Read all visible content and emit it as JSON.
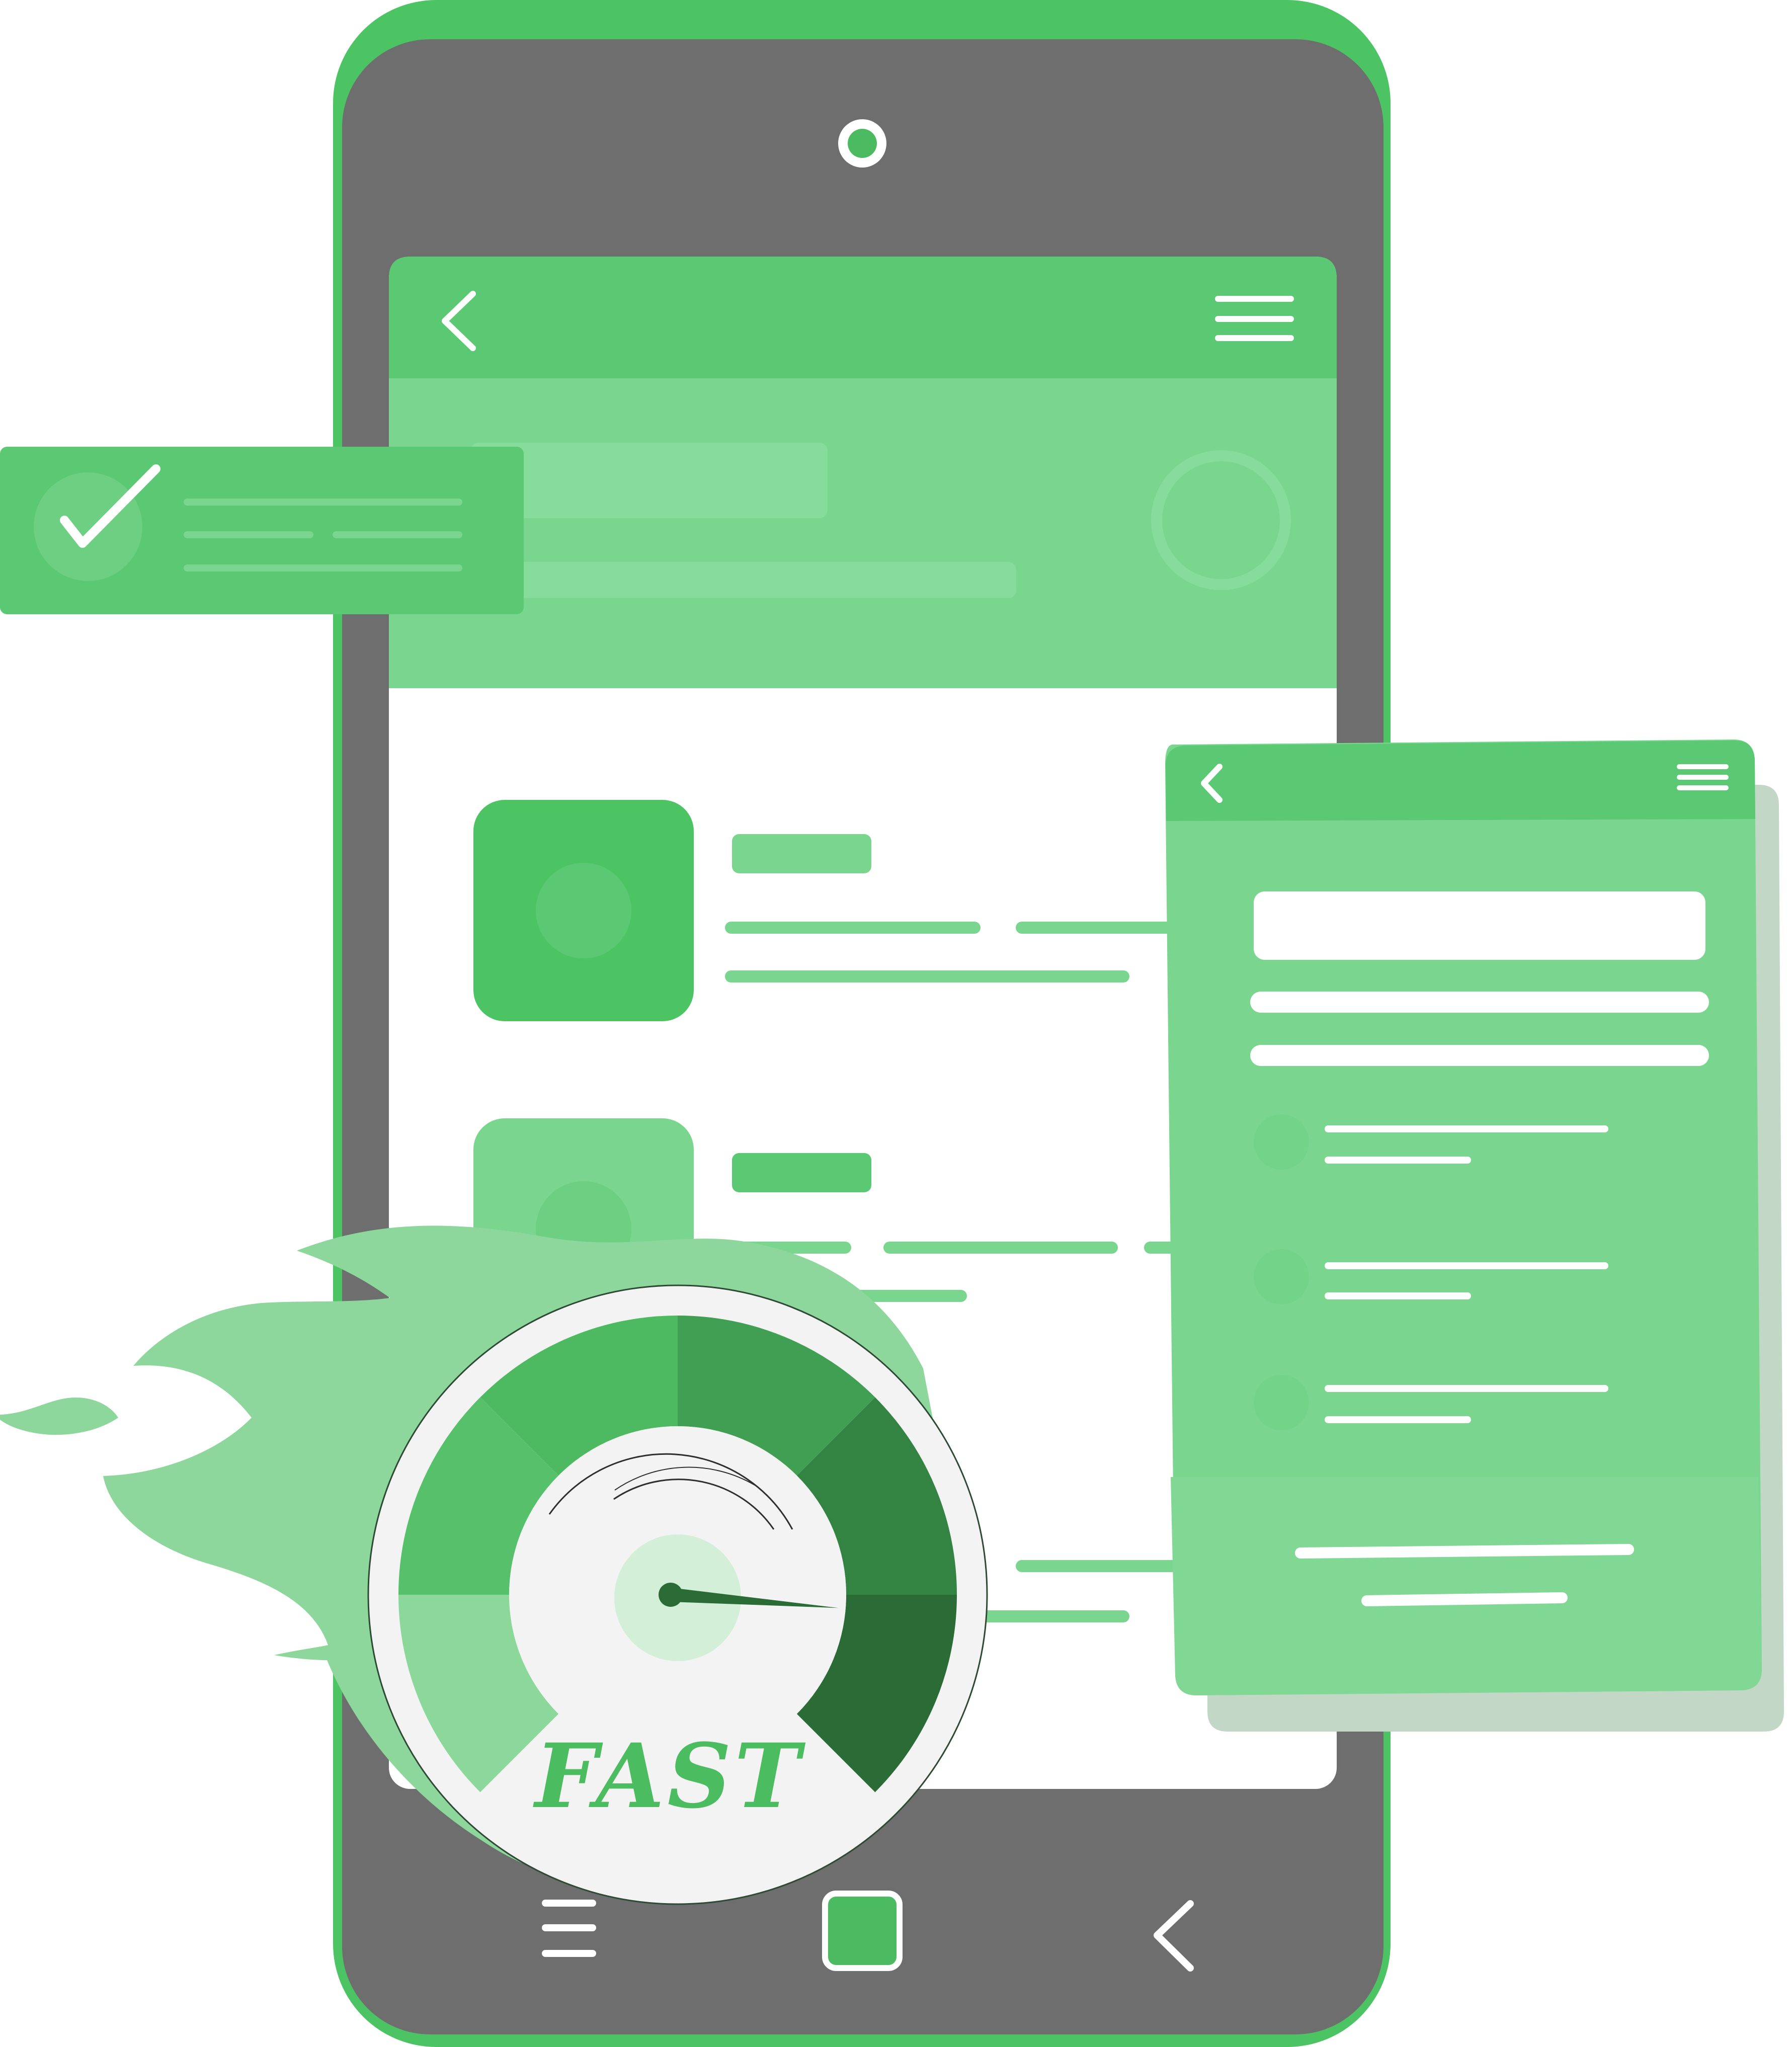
{
  "speedometer": {
    "label": "FAST",
    "level": 0.85,
    "segment_colors": [
      "#8cd79a",
      "#56c06a",
      "#4dba61",
      "#419f53",
      "#338443",
      "#2a6b36"
    ],
    "label_color": "#4cbc60"
  },
  "colors": {
    "phone_border": "#4cc463",
    "phone_body": "#6e6e6e",
    "header_green": "#5bc873",
    "banner_green": "#7ad68f",
    "content_bg": "#ffffff",
    "flame": "#8dd79c",
    "shadow_panel": "#c3d7c6"
  },
  "icons": {
    "camera": "camera-icon",
    "back": "chevron-left-icon",
    "menu": "hamburger-menu-icon",
    "check": "checkmark-icon",
    "home": "home-square-icon"
  }
}
